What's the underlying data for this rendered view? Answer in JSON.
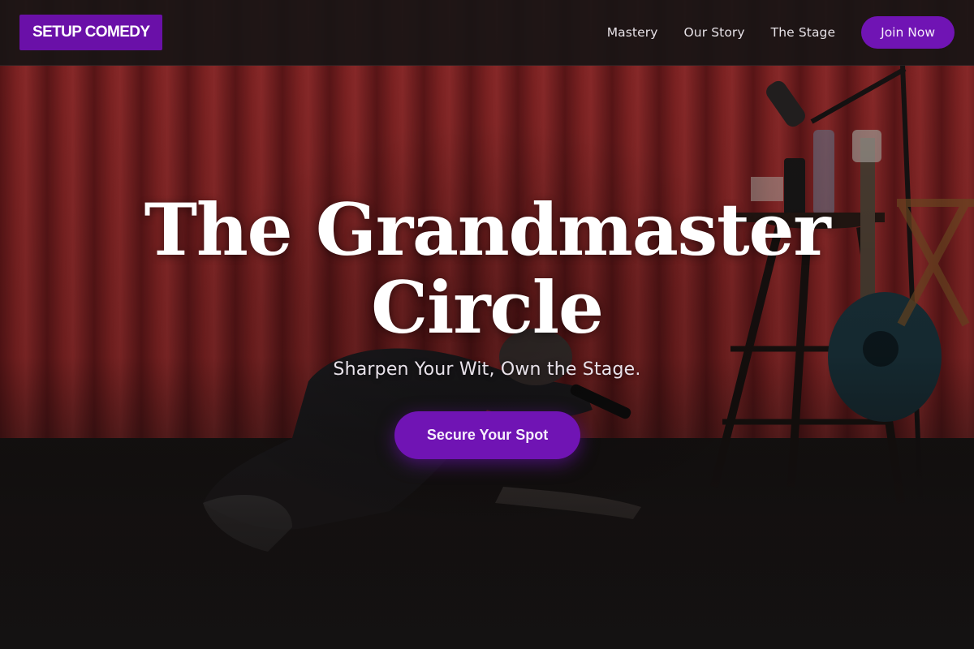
{
  "header": {
    "logo": "SETUP COMEDY",
    "nav": [
      {
        "label": "Mastery"
      },
      {
        "label": "Our Story"
      },
      {
        "label": "The Stage"
      }
    ],
    "join_label": "Join Now"
  },
  "hero": {
    "title_line1": "The Grandmaster",
    "title_line2": "Circle",
    "subtitle": "Sharpen Your Wit, Own the Stage.",
    "cta_label": "Secure Your Spot",
    "background_image": "comedian on stage with microphone in front of red curtain, stool and guitar"
  },
  "colors": {
    "accent": "#7014b4",
    "logo_bg": "#6a10a8",
    "header_bg": "#181414",
    "curtain": "#8a2424",
    "text": "#ffffff"
  }
}
